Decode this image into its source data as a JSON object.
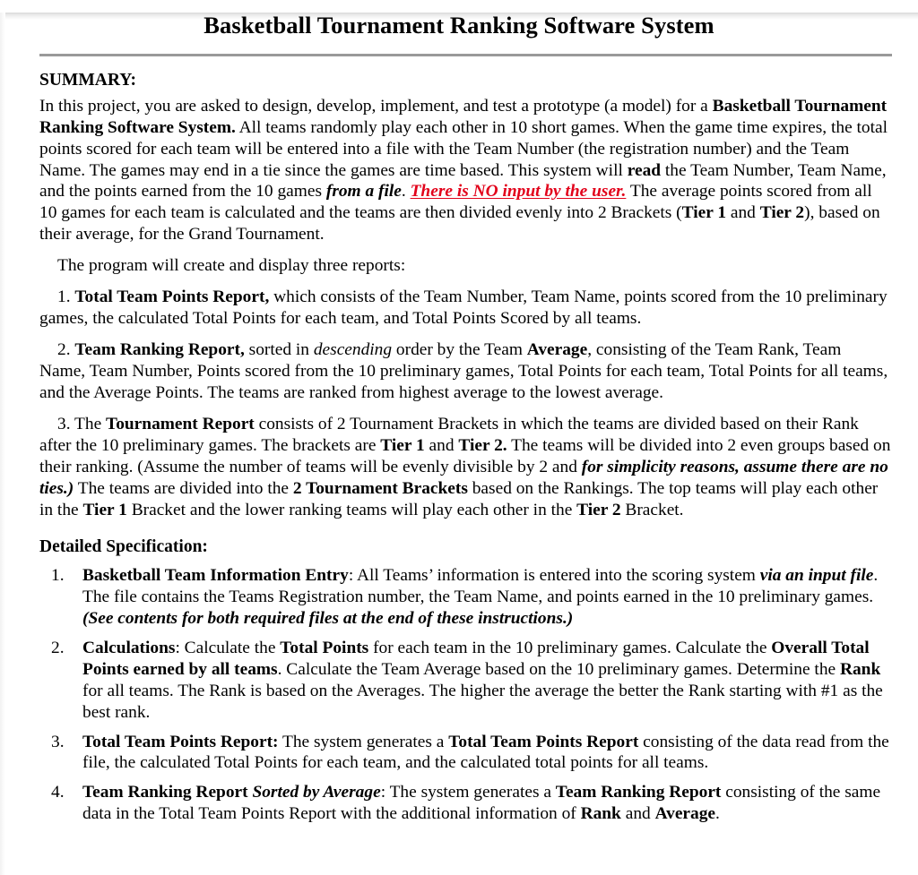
{
  "document": {
    "title": "Basketball Tournament Ranking Software System",
    "summary_heading": "SUMMARY:",
    "detailed_heading": "Detailed Specification:",
    "accent_red": "#e2001a",
    "divider_color": "#9a9a9a"
  },
  "summary": {
    "p1": {
      "seg1": "In this project, you are asked to design, develop, implement, and test a prototype (a model) for a ",
      "bold1": "Basketball Tournament Ranking Software System.",
      "seg2": " All teams randomly play each other in 10 short games. When the game time expires, the total points scored for each team will be entered into a file with the Team Number (the registration number) and the Team Name.  The games may end in a tie since the games are time based. This system will ",
      "bold2": "read",
      "seg3": " the Team Number, Team Name, and the points earned from the 10 games ",
      "bolditalic1": "from a file",
      "seg4": ". ",
      "red": "There is NO input by the user.",
      "seg5": " The average points scored from all 10 games for each team is calculated and the teams are then divided evenly into 2 Brackets (",
      "bold3": "Tier 1",
      "seg6": " and ",
      "bold4": "Tier 2",
      "seg7": "), based on their average, for the Grand Tournament."
    },
    "p2": "The program will create and display three reports:",
    "report1": {
      "number": "1. ",
      "bold1": "Total Team Points Report,",
      "seg1": " which consists of the Team Number, Team Name, points scored from the 10 preliminary games, the calculated Total Points for each team, and Total Points Scored by all teams."
    },
    "report2": {
      "number": "2. ",
      "bold1": "Team Ranking Report,",
      "seg1": " sorted in ",
      "italic1": "descending",
      "seg2": " order by the Team ",
      "bold2": "Average",
      "seg3": ", consisting of the Team Rank, Team Name, Team Number, Points scored from the 10 preliminary games, Total Points for each team, Total Points for all teams, and the Average Points. The teams are ranked from highest average to the lowest average."
    },
    "report3": {
      "number": "3. ",
      "seg0": "The ",
      "bold1": "Tournament Report",
      "seg1": " consists of 2 Tournament Brackets in which the teams are divided based on their Rank after the 10 preliminary games. The brackets are ",
      "bold2": "Tier 1",
      "seg2": " and ",
      "bold3": "Tier 2.",
      "seg3": " The teams will be divided into 2 even groups based on their ranking. (Assume the number of teams will be evenly divisible by 2 and ",
      "bolditalic1": "for simplicity reasons, assume there are no ties.)",
      "seg4": " The teams are divided into the ",
      "bold4": "2 Tournament Brackets",
      "seg5": " based on the Rankings. The top teams will play each other in the ",
      "bold5": "Tier 1",
      "seg6": " Bracket and the lower ranking teams will play each other in the ",
      "bold6": "Tier 2",
      "seg7": " Bracket."
    }
  },
  "spec_items": [
    {
      "number": "1.",
      "bold1": "Basketball Team Information Entry",
      "seg1": ": All Teams’ information is entered into the scoring system ",
      "bolditalic1": "via an input file",
      "seg2": ". The file contains the Teams Registration number, the Team Name, and points earned in the 10 preliminary games. ",
      "bolditalic2": "(See contents for both required files at the end of these instructions.)"
    },
    {
      "number": "2.",
      "bold1": "Calculations",
      "seg1": ":  Calculate the ",
      "bold2": "Total Points",
      "seg2": " for each team in the 10 preliminary games. Calculate the ",
      "bold3": "Overall Total Points earned by all teams",
      "seg3": ". Calculate the Team Average based on the 10 preliminary games. Determine the ",
      "bold4": "Rank",
      "seg4": " for all teams. The Rank is based on the Averages. The higher the average the better the Rank starting with #1 as the best rank."
    },
    {
      "number": "3.",
      "bold1": "Total Team Points Report:",
      "seg1": " The system generates a ",
      "bold2": "Total Team Points Report",
      "seg2": " consisting of the data read from the file, the calculated Total Points for each team, and the calculated total points for all teams."
    },
    {
      "number": "4.",
      "bold1": "Team Ranking Report",
      "bolditalic1": " Sorted by Average",
      "seg1": ": The system generates a ",
      "bold2": "Team Ranking Report",
      "seg2": " consisting of the same data in the Total Team Points Report with the additional information of ",
      "bold3": "Rank",
      "seg3": " and ",
      "bold4": "Average",
      "seg4": "."
    }
  ]
}
